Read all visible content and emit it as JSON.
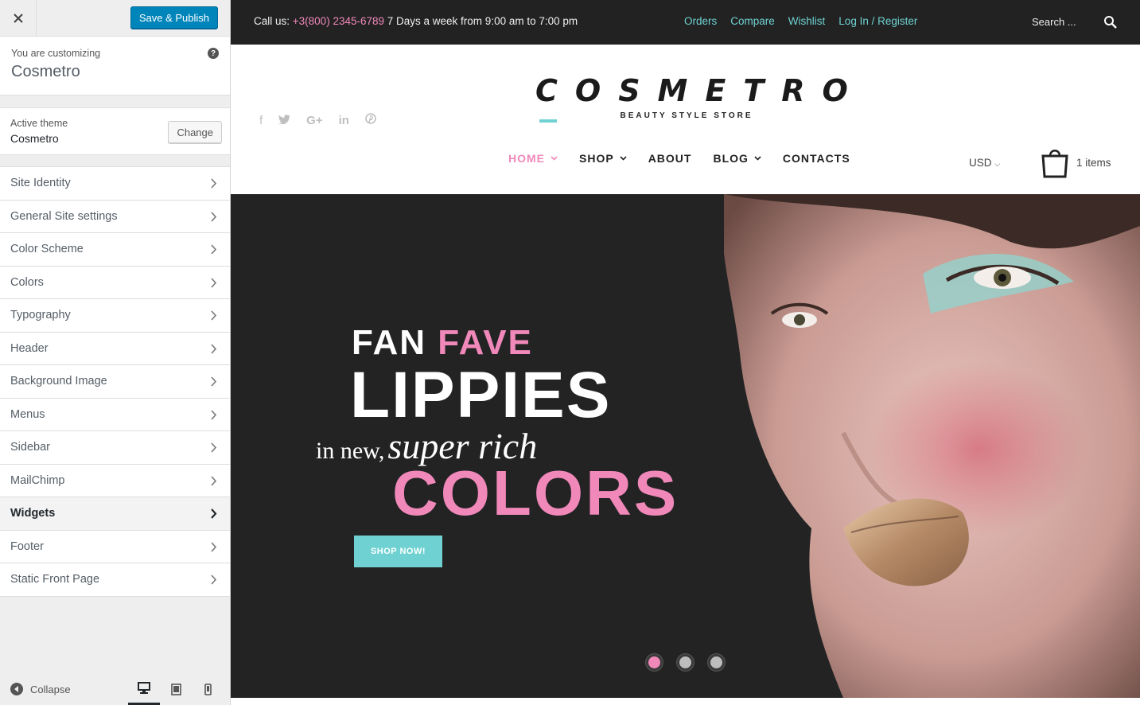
{
  "customizer": {
    "save_label": "Save & Publish",
    "customizing_label": "You are customizing",
    "site_name": "Cosmetro",
    "active_theme_label": "Active theme",
    "active_theme": "Cosmetro",
    "change_label": "Change",
    "sections": [
      {
        "label": "Site Identity"
      },
      {
        "label": "General Site settings"
      },
      {
        "label": "Color Scheme"
      },
      {
        "label": "Colors"
      },
      {
        "label": "Typography"
      },
      {
        "label": "Header"
      },
      {
        "label": "Background Image"
      },
      {
        "label": "Menus"
      },
      {
        "label": "Sidebar"
      },
      {
        "label": "MailChimp"
      },
      {
        "label": "Widgets"
      },
      {
        "label": "Footer"
      },
      {
        "label": "Static Front Page"
      }
    ],
    "active_section": "Widgets",
    "collapse_label": "Collapse",
    "devices": [
      "desktop-icon",
      "tablet-icon",
      "mobile-icon"
    ]
  },
  "preview": {
    "topbar": {
      "call_label": "Call us:",
      "phone": "+3(800) 2345-6789",
      "hours": "7 Days a week from 9:00 am to 7:00 pm",
      "links": [
        "Orders",
        "Compare",
        "Wishlist",
        "Log In / Register"
      ],
      "search_placeholder": "Search ..."
    },
    "header": {
      "social": [
        "facebook-icon",
        "twitter-icon",
        "google-plus-icon",
        "linkedin-icon",
        "pinterest-icon"
      ],
      "logo": "COSMETRO",
      "tagline": "BEAUTY STYLE STORE",
      "currency": "USD",
      "cart_items": "1 items"
    },
    "nav": [
      {
        "label": "HOME",
        "caret": true
      },
      {
        "label": "SHOP",
        "caret": true
      },
      {
        "label": "ABOUT",
        "caret": false
      },
      {
        "label": "BLOG",
        "caret": true
      },
      {
        "label": "CONTACTS",
        "caret": false
      }
    ],
    "hero": {
      "line1a": "FAN",
      "line1b": "FAVE",
      "line2": "LIPPIES",
      "line3a": "in new,",
      "line3b": "super rich",
      "line4": "COLORS",
      "button": "SHOP NOW!",
      "slides": 3,
      "active_slide": 1
    },
    "colors": {
      "accent_pink": "#f088ba",
      "accent_teal": "#6fd1d1",
      "dark": "#222222"
    }
  }
}
